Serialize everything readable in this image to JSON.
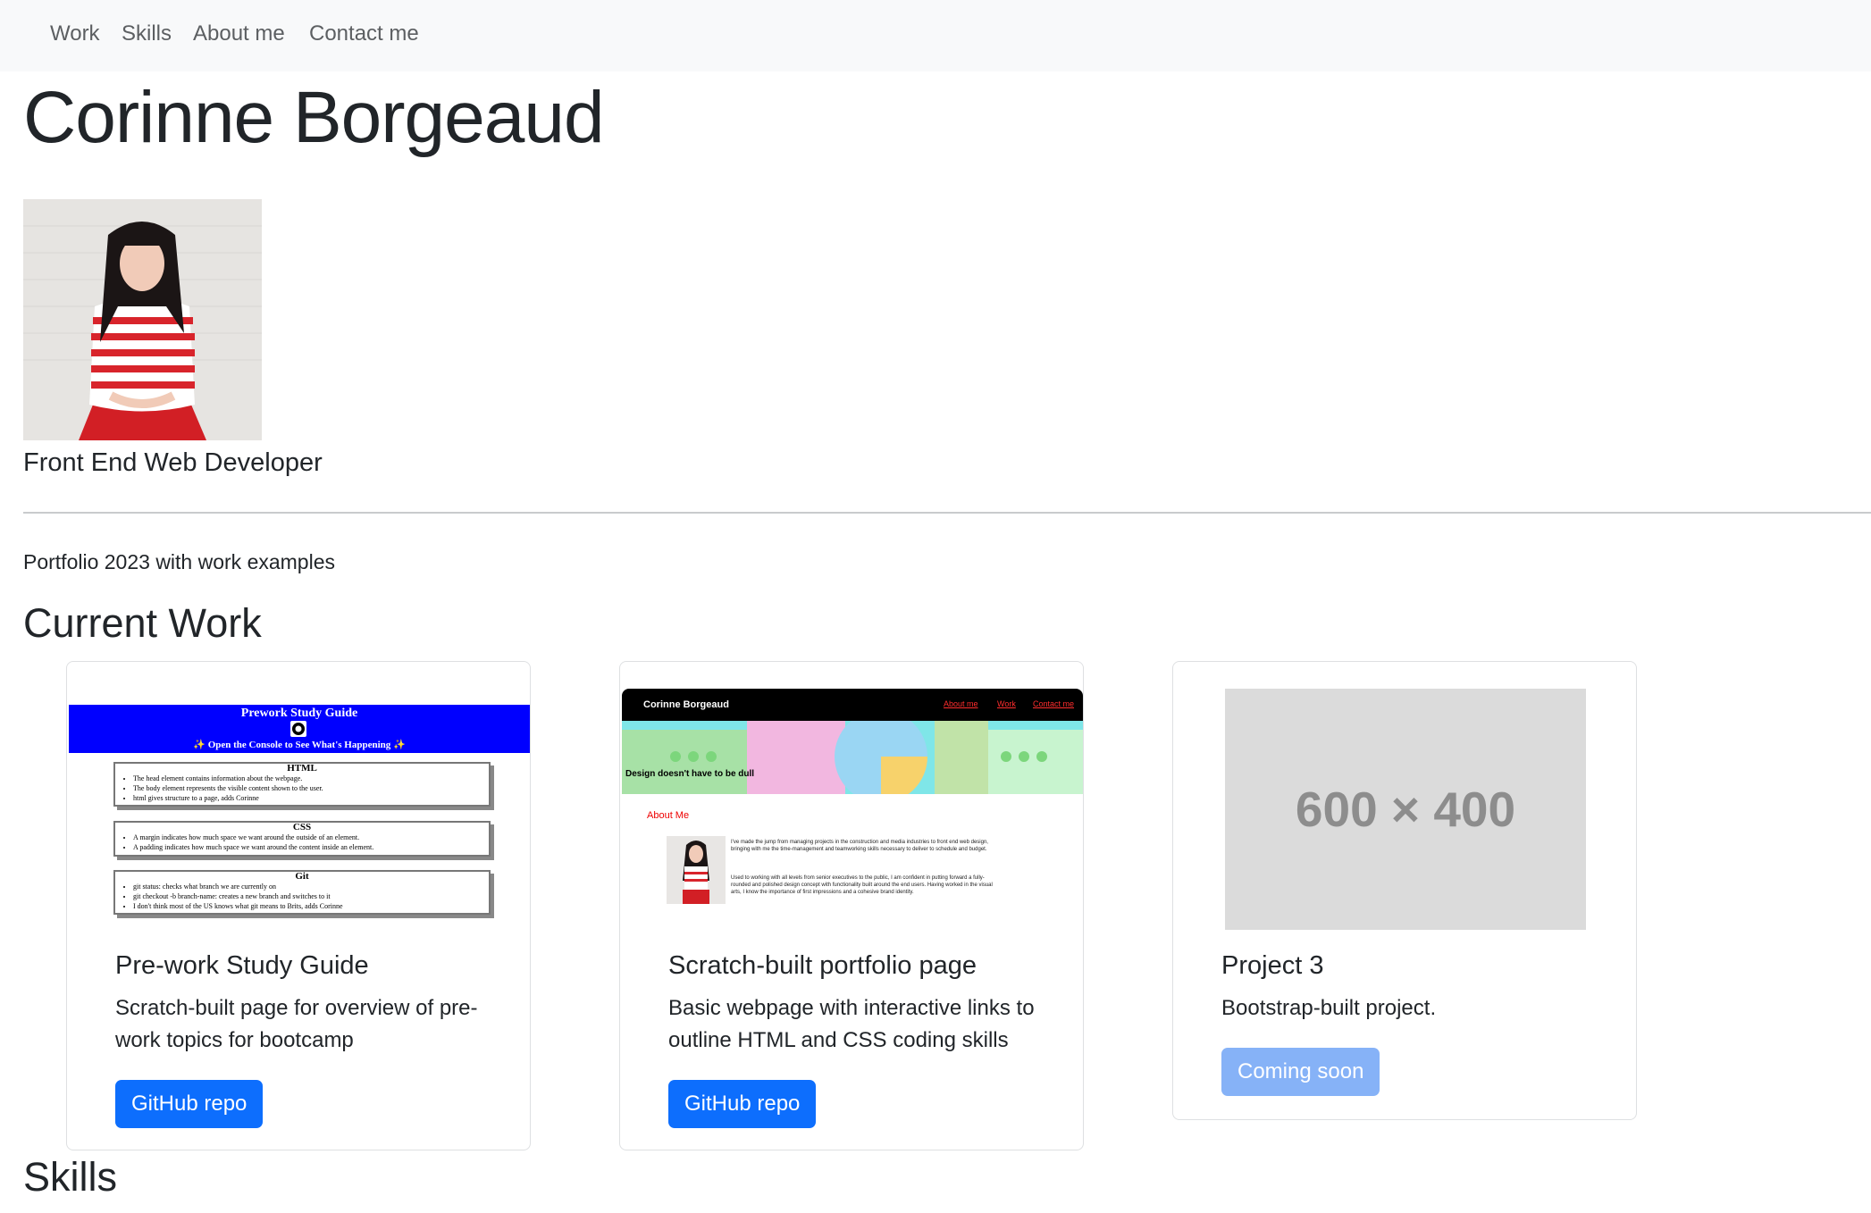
{
  "nav": {
    "items": [
      {
        "label": "Work"
      },
      {
        "label": "Skills"
      },
      {
        "label": "About me"
      },
      {
        "label": "Contact me"
      }
    ]
  },
  "hero": {
    "name": "Corinne Borgeaud",
    "role": "Front End Web Developer"
  },
  "intro": "Portfolio 2023 with work examples",
  "sections": {
    "current_work": "Current Work",
    "skills": "Skills"
  },
  "cards": [
    {
      "title": "Pre-work Study Guide",
      "text": "Scratch-built page for overview of pre-work topics for bootcamp",
      "button": "GitHub repo",
      "preview": {
        "title": "Prework Study Guide",
        "subtitle": "✨ Open the Console to See What's Happening ✨",
        "sections": [
          {
            "heading": "HTML",
            "items": [
              "The head element contains information about the webpage.",
              "The body element represents the visible content shown to the user.",
              "html gives structure to a page, adds Corinne"
            ]
          },
          {
            "heading": "CSS",
            "items": [
              "A margin indicates how much space we want around the outside of an element.",
              "A padding indicates how much space we want around the content inside an element."
            ]
          },
          {
            "heading": "Git",
            "items": [
              "git status: checks what branch we are currently on",
              "git checkout -b branch-name: creates a new branch and switches to it",
              "I don't think most of the US knows what git means to Brits, adds Corinne"
            ]
          }
        ]
      }
    },
    {
      "title": "Scratch-built portfolio page",
      "text": "Basic webpage with interactive links to outline HTML and CSS coding skills",
      "button": "GitHub repo",
      "preview": {
        "brand": "Corinne Borgeaud",
        "links": [
          "About me",
          "Work",
          "Contact me"
        ],
        "hero_text": "Design doesn't have to be dull",
        "about_heading": "About Me",
        "para1": "I've made the jump from managing projects in the construction and media industries to front end web design, bringing with me the time-management and teamworking skills necessary to deliver to schedule and budget.",
        "para2": "Used to working with all levels from senior executives to the public, I am confident in putting forward a fully-rounded and polished design concept with functionality built around the end users. Having worked in the visual arts, I know the importance of first impressions and a cohesive brand identity."
      }
    },
    {
      "title": "Project 3",
      "text": "Bootstrap-built project.",
      "button": "Coming soon",
      "placeholder": "600 × 400"
    }
  ],
  "colors": {
    "primary": "#0d6efd",
    "primary_disabled": "#86b2f7",
    "navbar_bg": "#f8f9fa",
    "study_guide_banner": "#0000ff"
  }
}
